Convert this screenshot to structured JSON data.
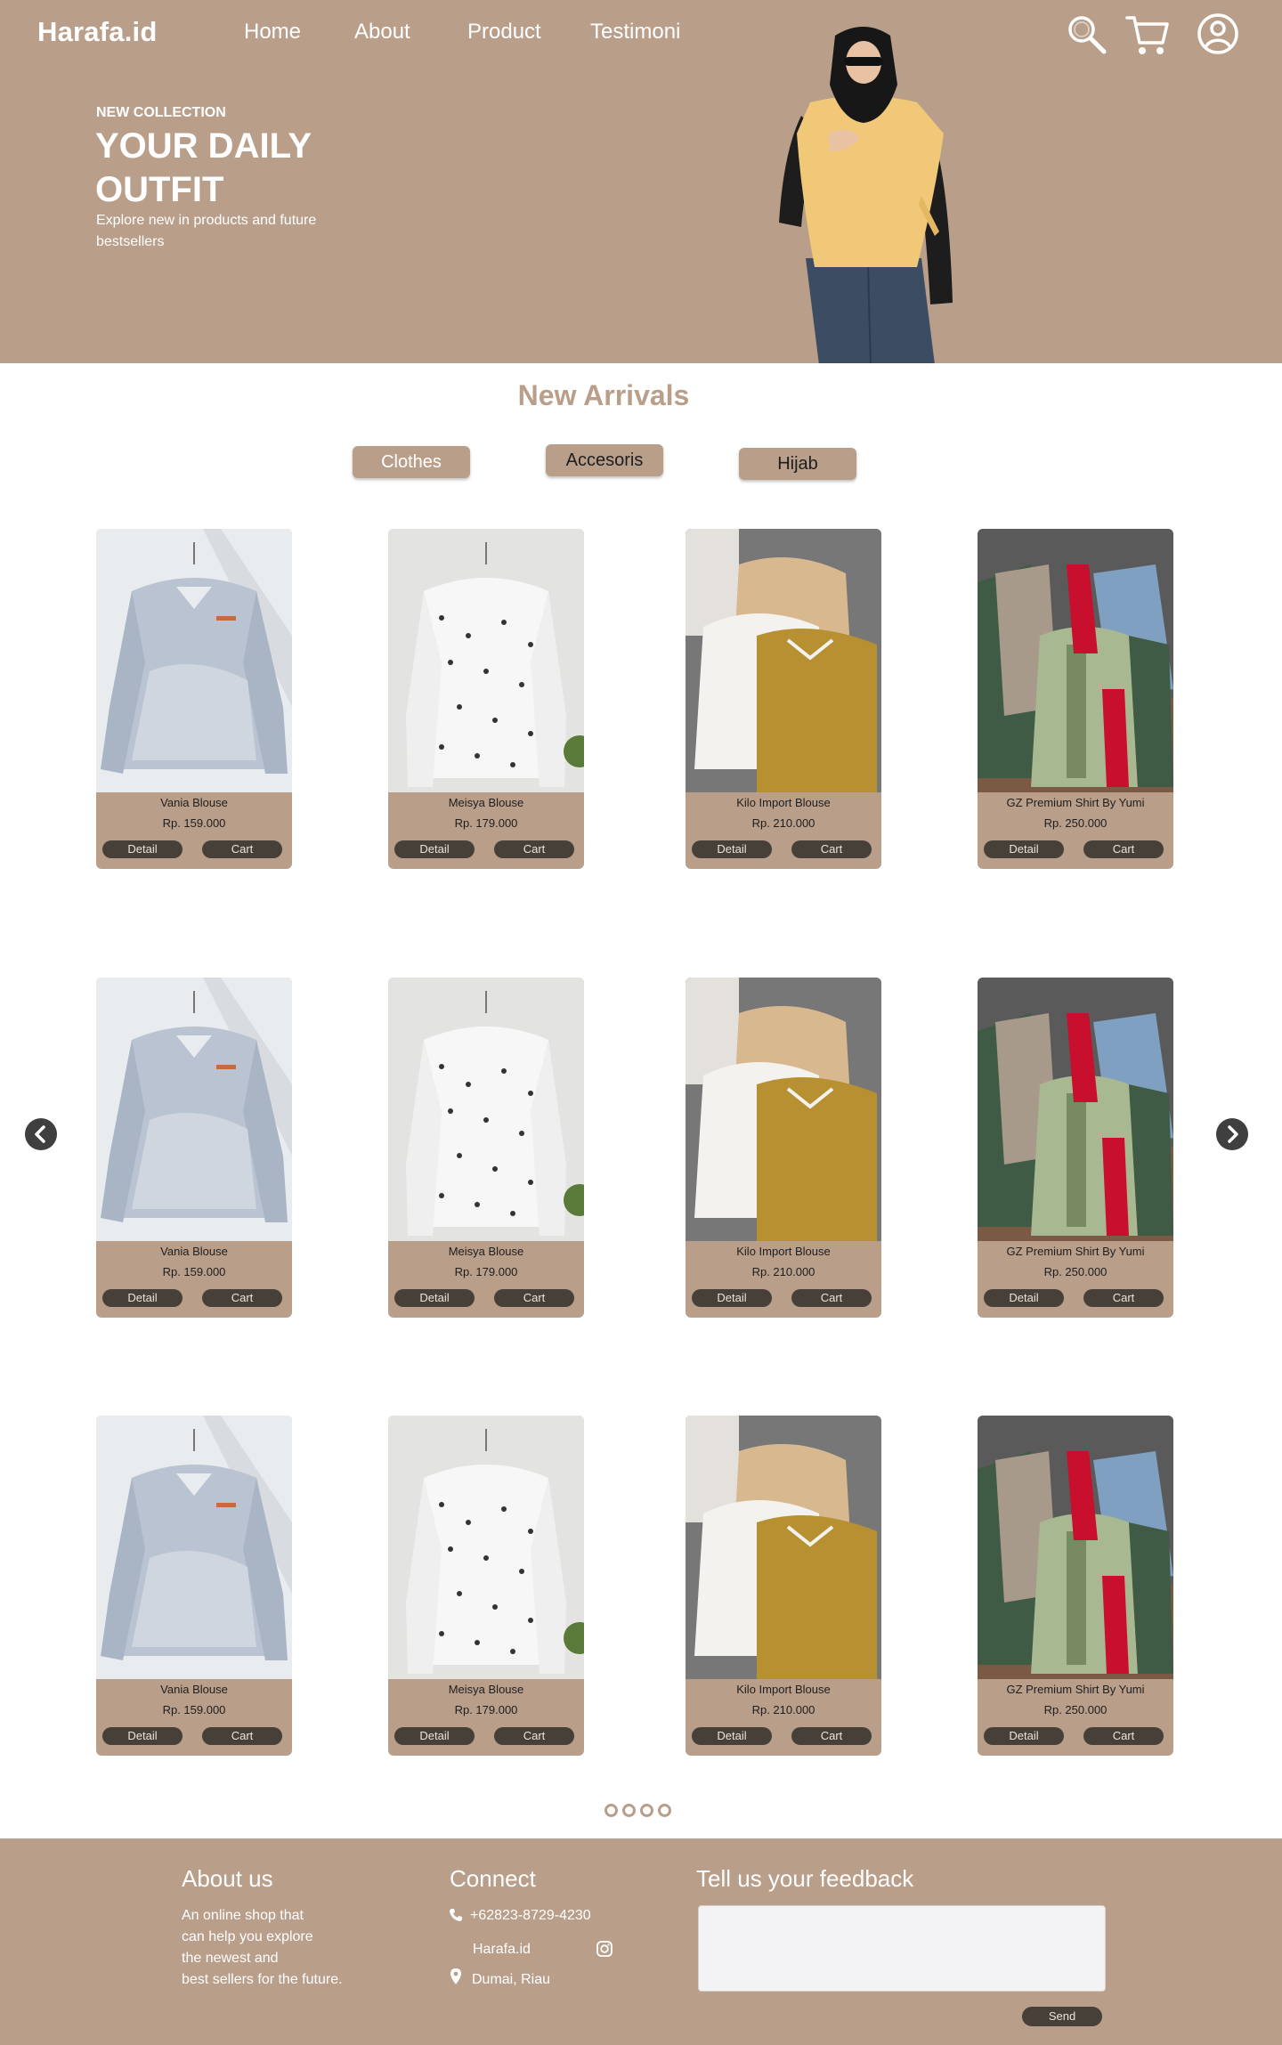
{
  "brand": {
    "logo": "Harafa.id",
    "accent": "#b99e8a",
    "button_dark": "#474038"
  },
  "nav": [
    {
      "label": "Home"
    },
    {
      "label": "About"
    },
    {
      "label": "Product"
    },
    {
      "label": "Testimoni"
    }
  ],
  "header_icons": [
    "search-icon",
    "cart-icon",
    "user-icon"
  ],
  "hero": {
    "kicker": "NEW COLLECTION",
    "headline": "YOUR DAILY OUTFIT",
    "subtitle": "Explore new in products and future bestsellers"
  },
  "arrivals": {
    "title": "New Arrivals",
    "categories": [
      {
        "label": "Clothes"
      },
      {
        "label": "Accesoris"
      },
      {
        "label": "Hijab"
      }
    ],
    "products": [
      {
        "name": "Vania Blouse",
        "price": "Rp. 159.000",
        "detail": "Detail",
        "cart": "Cart"
      },
      {
        "name": "Meisya Blouse",
        "price": "Rp. 179.000",
        "detail": "Detail",
        "cart": "Cart"
      },
      {
        "name": "Kilo Import Blouse",
        "price": "Rp. 210.000",
        "detail": "Detail",
        "cart": "Cart"
      },
      {
        "name": "GZ Premium Shirt By Yumi",
        "price": "Rp. 250.000",
        "detail": "Detail",
        "cart": "Cart"
      },
      {
        "name": "Vania Blouse",
        "price": "Rp. 159.000",
        "detail": "Detail",
        "cart": "Cart"
      },
      {
        "name": "Meisya Blouse",
        "price": "Rp. 179.000",
        "detail": "Detail",
        "cart": "Cart"
      },
      {
        "name": "Kilo Import Blouse",
        "price": "Rp. 210.000",
        "detail": "Detail",
        "cart": "Cart"
      },
      {
        "name": "GZ Premium Shirt By Yumi",
        "price": "Rp. 250.000",
        "detail": "Detail",
        "cart": "Cart"
      },
      {
        "name": "Vania Blouse",
        "price": "Rp. 159.000",
        "detail": "Detail",
        "cart": "Cart"
      },
      {
        "name": "Meisya Blouse",
        "price": "Rp. 179.000",
        "detail": "Detail",
        "cart": "Cart"
      },
      {
        "name": "Kilo Import Blouse",
        "price": "Rp. 210.000",
        "detail": "Detail",
        "cart": "Cart"
      },
      {
        "name": "GZ Premium Shirt By Yumi",
        "price": "Rp. 250.000",
        "detail": "Detail",
        "cart": "Cart"
      }
    ],
    "pagination_pages": 4
  },
  "footer": {
    "about_title": "About us",
    "about_lines": [
      "An online shop that",
      "can help you explore",
      "the newest and",
      "best sellers for the future."
    ],
    "connect_title": "Connect",
    "phone": "+62823-8729-4230",
    "instagram": "Harafa.id",
    "location": "Dumai, Riau",
    "feedback_title": "Tell us your feedback",
    "send_label": "Send"
  }
}
